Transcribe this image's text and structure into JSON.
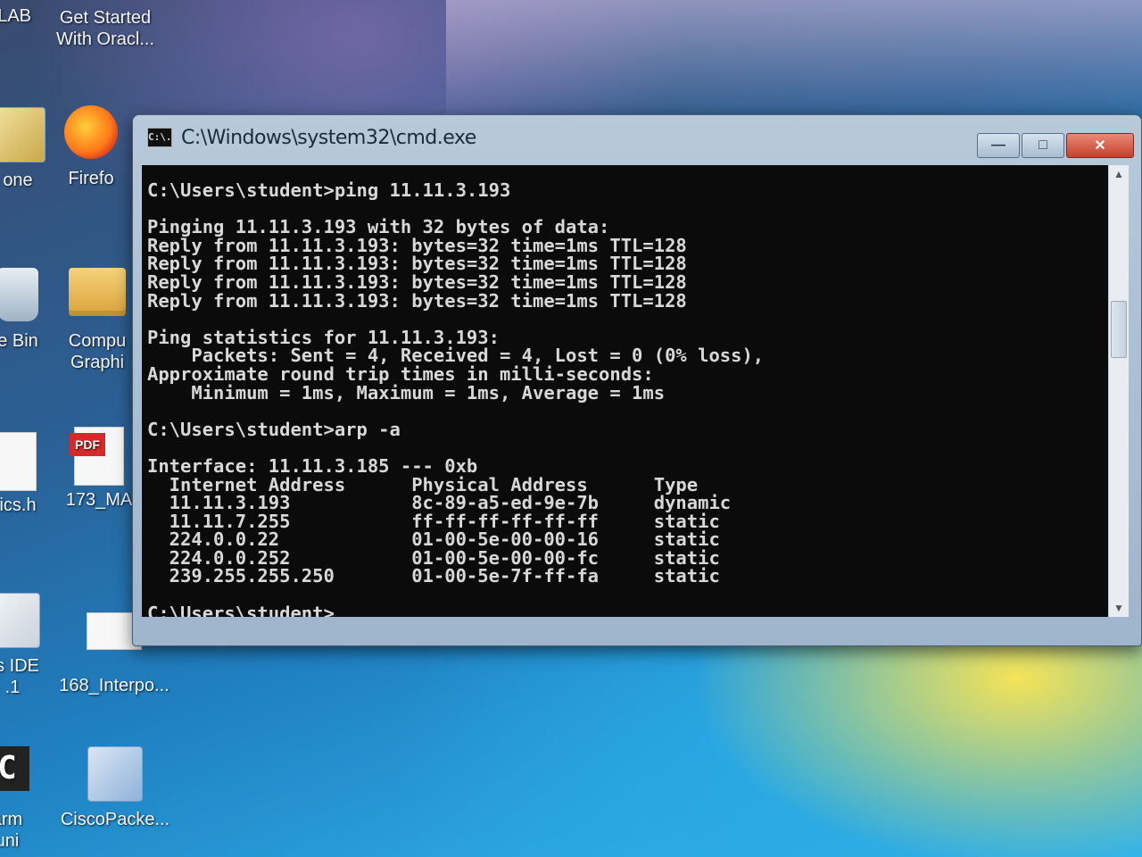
{
  "desktop": {
    "icons": [
      {
        "label": "TLAB"
      },
      {
        "label_line1": "Get Started",
        "label_line2": "With Oracl..."
      },
      {
        "label": "one"
      },
      {
        "label": "Firefo"
      },
      {
        "label": "e Bin"
      },
      {
        "label_line1": "Compu",
        "label_line2": "Graphi"
      },
      {
        "label": "ics.h"
      },
      {
        "label": "173_MA",
        "pdf_tag": "PDF"
      },
      {
        "label_line1": "ns IDE",
        "label_line2": ".1"
      },
      {
        "label": "168_Interpo..."
      },
      {
        "label_line1": "arm",
        "label_line2": "uni"
      },
      {
        "label": "CiscoPacke..."
      }
    ]
  },
  "window": {
    "title": "C:\\Windows\\system32\\cmd.exe",
    "icon_text": "C:\\.",
    "minimize": "—",
    "maximize": "□",
    "close": "✕"
  },
  "console": {
    "lines": [
      "C:\\Users\\student>ping 11.11.3.193",
      "",
      "Pinging 11.11.3.193 with 32 bytes of data:",
      "Reply from 11.11.3.193: bytes=32 time=1ms TTL=128",
      "Reply from 11.11.3.193: bytes=32 time=1ms TTL=128",
      "Reply from 11.11.3.193: bytes=32 time=1ms TTL=128",
      "Reply from 11.11.3.193: bytes=32 time=1ms TTL=128",
      "",
      "Ping statistics for 11.11.3.193:",
      "    Packets: Sent = 4, Received = 4, Lost = 0 (0% loss),",
      "Approximate round trip times in milli-seconds:",
      "    Minimum = 1ms, Maximum = 1ms, Average = 1ms",
      "",
      "C:\\Users\\student>arp -a",
      "",
      "Interface: 11.11.3.185 --- 0xb",
      "  Internet Address      Physical Address      Type",
      "  11.11.3.193           8c-89-a5-ed-9e-7b     dynamic",
      "  11.11.7.255           ff-ff-ff-ff-ff-ff     static",
      "  224.0.0.22            01-00-5e-00-00-16     static",
      "  224.0.0.252           01-00-5e-00-00-fc     static",
      "  239.255.255.250       01-00-5e-7f-ff-fa     static",
      "",
      "C:\\Users\\student>"
    ]
  }
}
